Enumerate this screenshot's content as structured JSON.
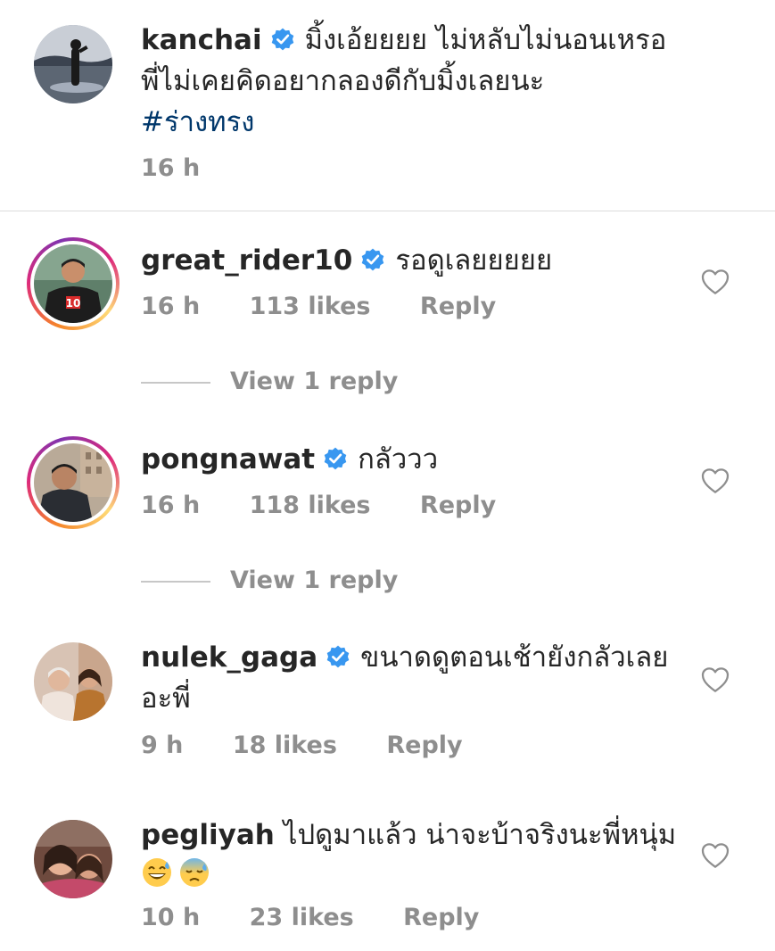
{
  "caption": {
    "username": "kanchai",
    "text_line1": "มิ้งเอ้ยยยย ไม่หลับไม่นอนเหรอ",
    "text_line2": "พี่ไม่เคยคิดอยากลองดีกับมิ้งเลยนะ",
    "hashtag": "#ร่างทรง",
    "time": "16 h"
  },
  "comments": [
    {
      "username": "great_rider10",
      "text": "รอดูเลยยยยย",
      "time": "16 h",
      "likes": "113 likes",
      "reply_label": "Reply",
      "view_replies": "View 1 reply"
    },
    {
      "username": "pongnawat",
      "text": "กลัววว",
      "time": "16 h",
      "likes": "118 likes",
      "reply_label": "Reply",
      "view_replies": "View 1 reply"
    },
    {
      "username": "nulek_gaga",
      "text_line1": "ขนาดดูตอนเช้ายังกลัวเลย",
      "text_line2": "อะพี่",
      "time": "9 h",
      "likes": "18 likes",
      "reply_label": "Reply"
    },
    {
      "username": "pegliyah",
      "text_line1": "ไปดูมาแล้ว น่าจะบ้าจริงนะพี่หนุ่ม",
      "emojis": [
        "grinning-sweat-emoji",
        "cold-sweat-emoji"
      ],
      "time": "10 h",
      "likes": "23 likes",
      "reply_label": "Reply"
    }
  ],
  "colors": {
    "verified_blue": "#3897f0",
    "hashtag": "#00376b",
    "meta_gray": "#8e8e8e",
    "divider": "#dbdbdb"
  }
}
